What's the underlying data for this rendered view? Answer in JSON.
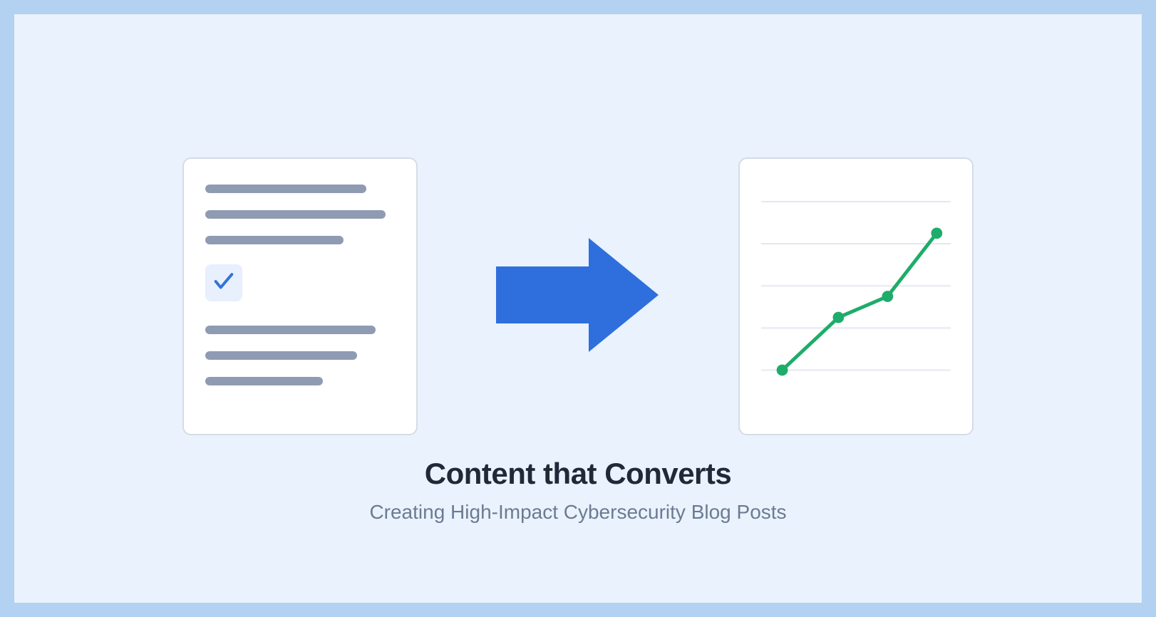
{
  "title": "Content that Converts",
  "subtitle": "Creating High-Impact Cybersecurity Blog Posts",
  "colors": {
    "outer_bg": "#b3d1f0",
    "inner_bg": "#eaf2fd",
    "card_bg": "#ffffff",
    "card_border": "#d6dce5",
    "line_fill": "#8f9bb3",
    "arrow_fill": "#2f6fdd",
    "chart_line": "#1eac6a",
    "chart_grid": "#e3e8f0",
    "check_bg": "#e8f0fe",
    "check_stroke": "#3572d6",
    "title_color": "#1f2937",
    "subtitle_color": "#6b7b93"
  },
  "chart_data": {
    "type": "line",
    "x": [
      1,
      2,
      3,
      4
    ],
    "values": [
      20,
      45,
      55,
      85
    ],
    "ylim": [
      0,
      100
    ],
    "gridlines": 5,
    "title": "",
    "xlabel": "",
    "ylabel": ""
  }
}
